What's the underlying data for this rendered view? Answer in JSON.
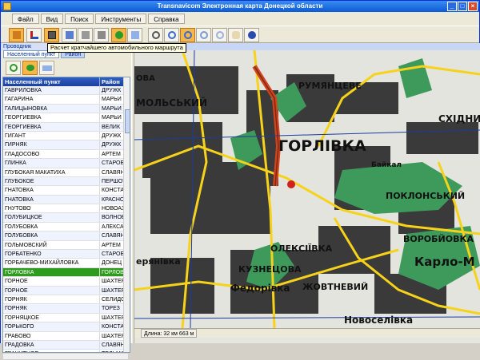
{
  "window": {
    "title": "Transnavicom Электронная карта Донецкой области"
  },
  "menu": [
    "Файл",
    "Вид",
    "Поиск",
    "Инструменты",
    "Справка"
  ],
  "tooltip": "Расчет кратчайшего автомобильного маршрута",
  "panel": {
    "caption": "Проводник",
    "tabs": [
      "Населенный пункт",
      "Район"
    ],
    "columns": [
      "Населенный пункт",
      "Район"
    ],
    "rows": [
      [
        "ГАВРИЛОВКА",
        "ДРУЖК"
      ],
      [
        "ГАГАРИНА",
        "МАРЬИ"
      ],
      [
        "ГАЛИЦЫНОВКА",
        "МАРЬИ"
      ],
      [
        "ГЕОРГИЕВКА",
        "МАРЬИ"
      ],
      [
        "ГЕОРГИЕВКА",
        "ВЕЛИК"
      ],
      [
        "ГИГАНТ",
        "ДРУЖК"
      ],
      [
        "ГИРНЯК",
        "ДРУЖК"
      ],
      [
        "ГЛАДОСОВО",
        "АРТЕМ"
      ],
      [
        "ГЛИНКА",
        "СТАРОБ"
      ],
      [
        "ГЛУБОКАЯ МАКАТИХА",
        "СЛАВЯН"
      ],
      [
        "ГЛУБОКОЕ",
        "ПЕРШОТ"
      ],
      [
        "ГНАТОВКА",
        "КОНСТА"
      ],
      [
        "ГНАТОВКА",
        "КРАСНО"
      ],
      [
        "ГНУТОВО",
        "НОВОАЗ"
      ],
      [
        "ГОЛУБИЦКОЕ",
        "ВОЛНОВ"
      ],
      [
        "ГОЛУБОВКА",
        "АЛЕКСА"
      ],
      [
        "ГОЛУБОВКА",
        "СЛАВЯН"
      ],
      [
        "ГОЛЬМОВСКИЙ",
        "АРТЕМ"
      ],
      [
        "ГОРБАТЕНКО",
        "СТАРОБ"
      ],
      [
        "ГОРБАЧЕВО-МИХАЙЛОВКА",
        "ДОНЕЦ"
      ],
      [
        "ГОРЛОВКА",
        "ГОРЛОВ"
      ],
      [
        "ГОРНОЕ",
        "ШАХТЕР"
      ],
      [
        "ГОРНОЕ",
        "ШАХТЕР"
      ],
      [
        "ГОРНЯК",
        "СЕЛИДО"
      ],
      [
        "ГОРНЯК",
        "ТОРЕЗ"
      ],
      [
        "ГОРНЯЦКОЕ",
        "ШАХТЕР"
      ],
      [
        "ГОРЬКОГО",
        "КОНСТА"
      ],
      [
        "ГРАБОВО",
        "ШАХТЕР"
      ],
      [
        "ГРАДОВКА",
        "СЛАВЯН"
      ],
      [
        "ГРАНИТНОЕ",
        "ТЕЛЬМА"
      ]
    ],
    "selected_index": 20
  },
  "map": {
    "labels": {
      "gorlivka": "ГОРЛІВКА",
      "rumyantseve": "РУМЯНЦЕВЕ",
      "skhidny": "СХІДНИ",
      "mykolskyi": "МОЛЬСЬКИЙ",
      "poklonskyi": "ПОКЛОНСЬКИЙ",
      "vorobiovka": "ВОРОБЙОВКА",
      "karlo": "Карло-М",
      "oleksiivka": "ОЛЕКСІЇВКА",
      "kuznetsova": "КУЗНЕЦОВА",
      "fedorivka": "Федорівка",
      "zhovtnevyi": "ЖОВТНЕВИЙ",
      "novoselivka": "Новоселівка",
      "baikal": "Байкал",
      "zerianivka": "ерянівка",
      "mova": "ОВА"
    }
  },
  "status": {
    "distance": "Длина: 32 км 663 м"
  },
  "colors": {
    "selected_row": "#2e9a1e",
    "header": "#1c3f9e",
    "road_yellow": "#f7d21a",
    "road_red": "#d2431f"
  }
}
